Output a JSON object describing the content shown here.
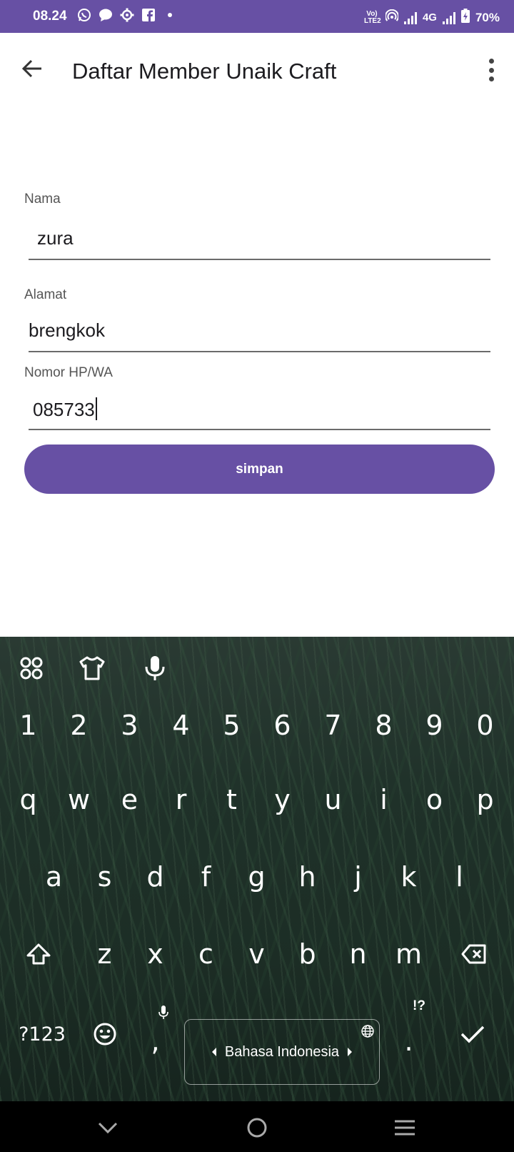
{
  "status_bar": {
    "time": "08.24",
    "network": "4G",
    "battery": "70%",
    "volte_label": "Vo) LTE2",
    "icons": [
      "whatsapp-icon",
      "chat-bubble-icon",
      "settings-icon",
      "facebook-icon",
      "dot-icon",
      "hotspot-icon",
      "signal-icon",
      "battery-charging-icon"
    ]
  },
  "app_bar": {
    "title": "Daftar Member Unaik Craft",
    "back_icon": "arrow-left-icon",
    "menu_icon": "more-vert-icon"
  },
  "form": {
    "nama": {
      "label": "Nama",
      "value": "zura"
    },
    "alamat": {
      "label": "Alamat",
      "value": "brengkok"
    },
    "nomor": {
      "label": "Nomor HP/WA",
      "value": "085733"
    },
    "submit_label": "simpan"
  },
  "keyboard": {
    "tools": [
      "apps-icon",
      "tshirt-icon",
      "mic-icon"
    ],
    "number_row": [
      "1",
      "2",
      "3",
      "4",
      "5",
      "6",
      "7",
      "8",
      "9",
      "0"
    ],
    "row1": [
      "q",
      "w",
      "e",
      "r",
      "t",
      "y",
      "u",
      "i",
      "o",
      "p"
    ],
    "row2": [
      "a",
      "s",
      "d",
      "f",
      "g",
      "h",
      "j",
      "k",
      "l"
    ],
    "row3": [
      "z",
      "x",
      "c",
      "v",
      "b",
      "n",
      "m"
    ],
    "symbols_label": "?123",
    "comma": ",",
    "period": ".",
    "period_hint": "!?",
    "space_label": "Bahasa Indonesia",
    "accent_color": "#6750a4"
  },
  "nav_bar": {
    "icons": [
      "chevron-down-icon",
      "home-circle-icon",
      "menu-lines-icon"
    ]
  }
}
